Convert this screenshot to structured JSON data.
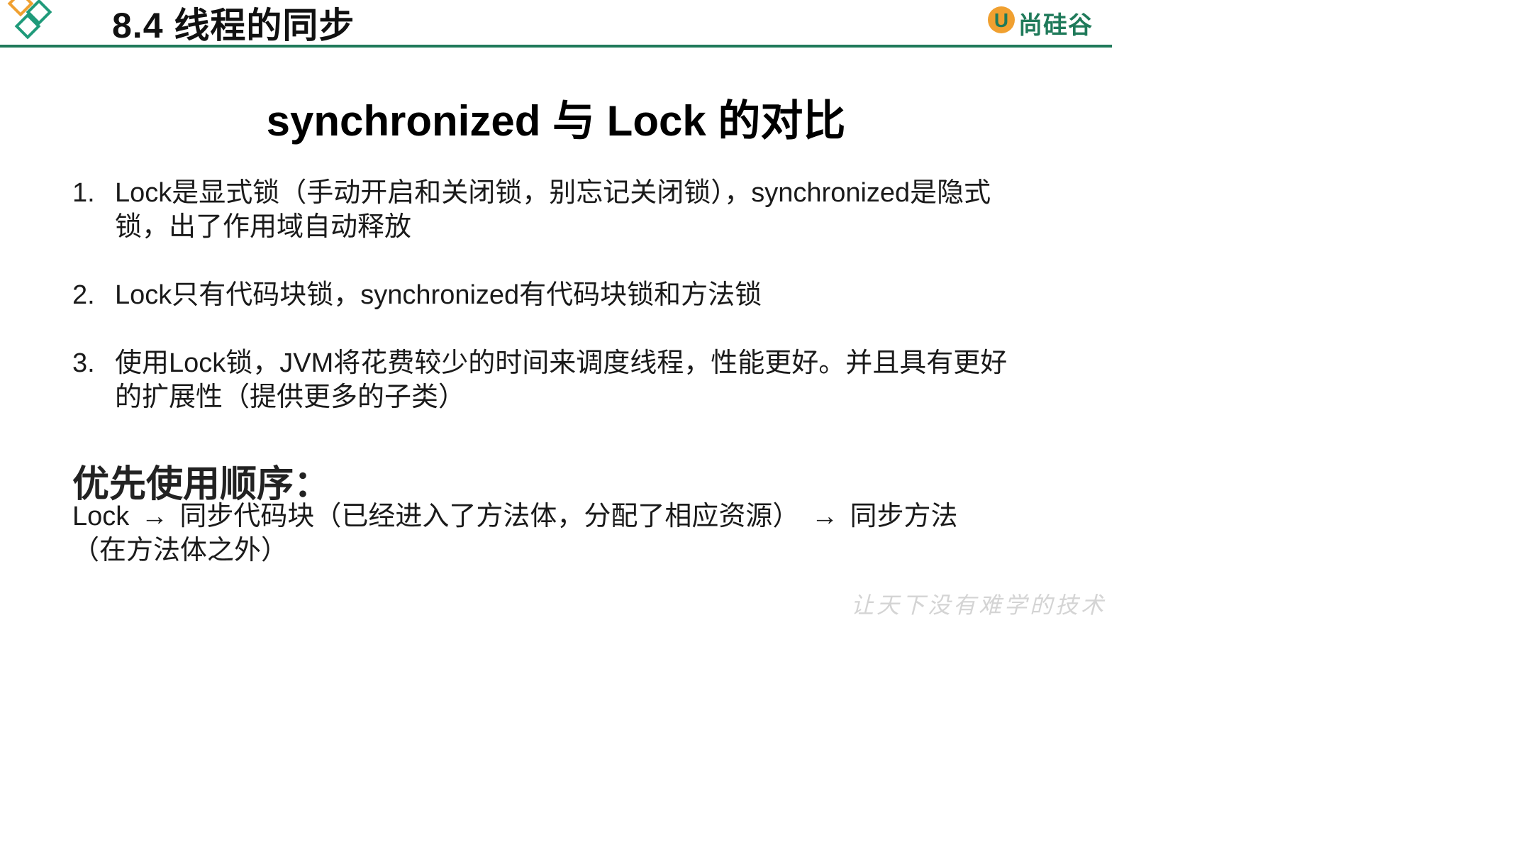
{
  "header": {
    "section_title": "8.4 线程的同步",
    "brand_name": "尚硅谷",
    "brand_letter": "U",
    "accent_color": "#1f7a5a",
    "logo_color": "#f0a030"
  },
  "slide": {
    "title": "synchronized 与 Lock 的对比",
    "points": [
      {
        "num": "1.",
        "text": "Lock是显式锁（手动开启和关闭锁，别忘记关闭锁），synchronized是隐式锁，出了作用域自动释放"
      },
      {
        "num": "2.",
        "text": "Lock只有代码块锁，synchronized有代码块锁和方法锁"
      },
      {
        "num": "3.",
        "text": "使用Lock锁，JVM将花费较少的时间来调度线程，性能更好。并且具有更好的扩展性（提供更多的子类）"
      }
    ],
    "order_heading": "优先使用顺序：",
    "order_items": [
      "Lock",
      "同步代码块（已经进入了方法体，分配了相应资源）",
      "同步方法（在方法体之外）"
    ],
    "arrow": "→",
    "watermark": "让天下没有难学的技术"
  }
}
